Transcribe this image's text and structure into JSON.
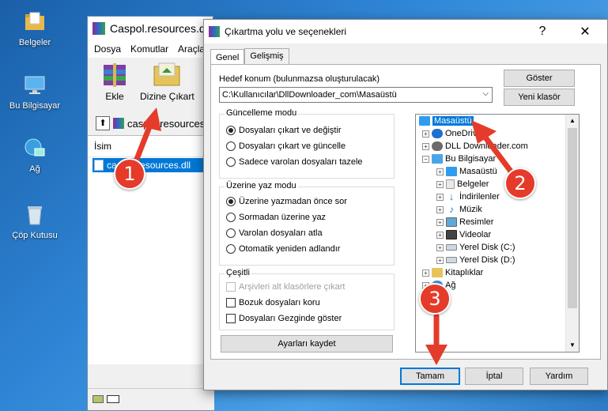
{
  "desktop": {
    "icons": [
      {
        "label": "Belgeler",
        "icon": "folder-icon"
      },
      {
        "label": "Bu Bilgisayar",
        "icon": "computer-icon"
      },
      {
        "label": "Ağ",
        "icon": "network-icon"
      },
      {
        "label": "Çöp Kutusu",
        "icon": "recycle-bin-icon"
      }
    ]
  },
  "rar_window": {
    "title": "Caspol.resources.dll",
    "menu": [
      "Dosya",
      "Komutlar",
      "Araçla"
    ],
    "toolbar": {
      "add_label": "Ekle",
      "extract_label": "Dizine Çıkart"
    },
    "address": "caspol.resources",
    "column_name": "İsim",
    "file_name": "caspol.resources.dll"
  },
  "dialog": {
    "title": "Çıkartma yolu ve seçenekleri",
    "help_glyph": "?",
    "close_glyph": "✕",
    "tabs": [
      "Genel",
      "Gelişmiş"
    ],
    "dest_label": "Hedef konum (bulunmazsa oluşturulacak)",
    "dest_value": "C:\\Kullanıcılar\\DllDownloader_com\\Masaüstü",
    "show_button": "Göster",
    "new_folder_button": "Yeni klasör",
    "update_group": {
      "label": "Güncelleme modu",
      "options": [
        "Dosyaları çıkart ve değiştir",
        "Dosyaları çıkart ve güncelle",
        "Sadece varolan dosyaları tazele"
      ],
      "selected": 0
    },
    "overwrite_group": {
      "label": "Üzerine yaz modu",
      "options": [
        "Üzerine yazmadan önce sor",
        "Sormadan üzerine yaz",
        "Varolan dosyaları atla",
        "Otomatik yeniden adlandır"
      ],
      "selected": 0
    },
    "misc_group": {
      "label": "Çeşitli",
      "options": [
        "Arşivleri alt klasörlere çıkart",
        "Bozuk dosyaları koru",
        "Dosyaları Gezginde göster"
      ]
    },
    "save_settings_button": "Ayarları kaydet",
    "tree": {
      "items": [
        {
          "label": "Masaüstü",
          "level": 0,
          "selected": true
        },
        {
          "label": "OneDrive",
          "level": 1
        },
        {
          "label": "DLL Downloader.com",
          "level": 1
        },
        {
          "label": "Bu Bilgisayar",
          "level": 1
        },
        {
          "label": "Masaüstü",
          "level": 2
        },
        {
          "label": "Belgeler",
          "level": 2
        },
        {
          "label": "İndirilenler",
          "level": 2
        },
        {
          "label": "Müzik",
          "level": 2
        },
        {
          "label": "Resimler",
          "level": 2
        },
        {
          "label": "Videolar",
          "level": 2
        },
        {
          "label": "Yerel Disk (C:)",
          "level": 2
        },
        {
          "label": "Yerel Disk (D:)",
          "level": 2
        },
        {
          "label": "Kitaplıklar",
          "level": 1
        },
        {
          "label": "Ağ",
          "level": 1
        }
      ]
    },
    "ok_button": "Tamam",
    "cancel_button": "İptal",
    "help_button": "Yardım"
  },
  "annotations": [
    "1",
    "2",
    "3"
  ],
  "colors": {
    "accent": "#0078d7",
    "annotation": "#e53b2a",
    "selection": "#0078d7"
  }
}
